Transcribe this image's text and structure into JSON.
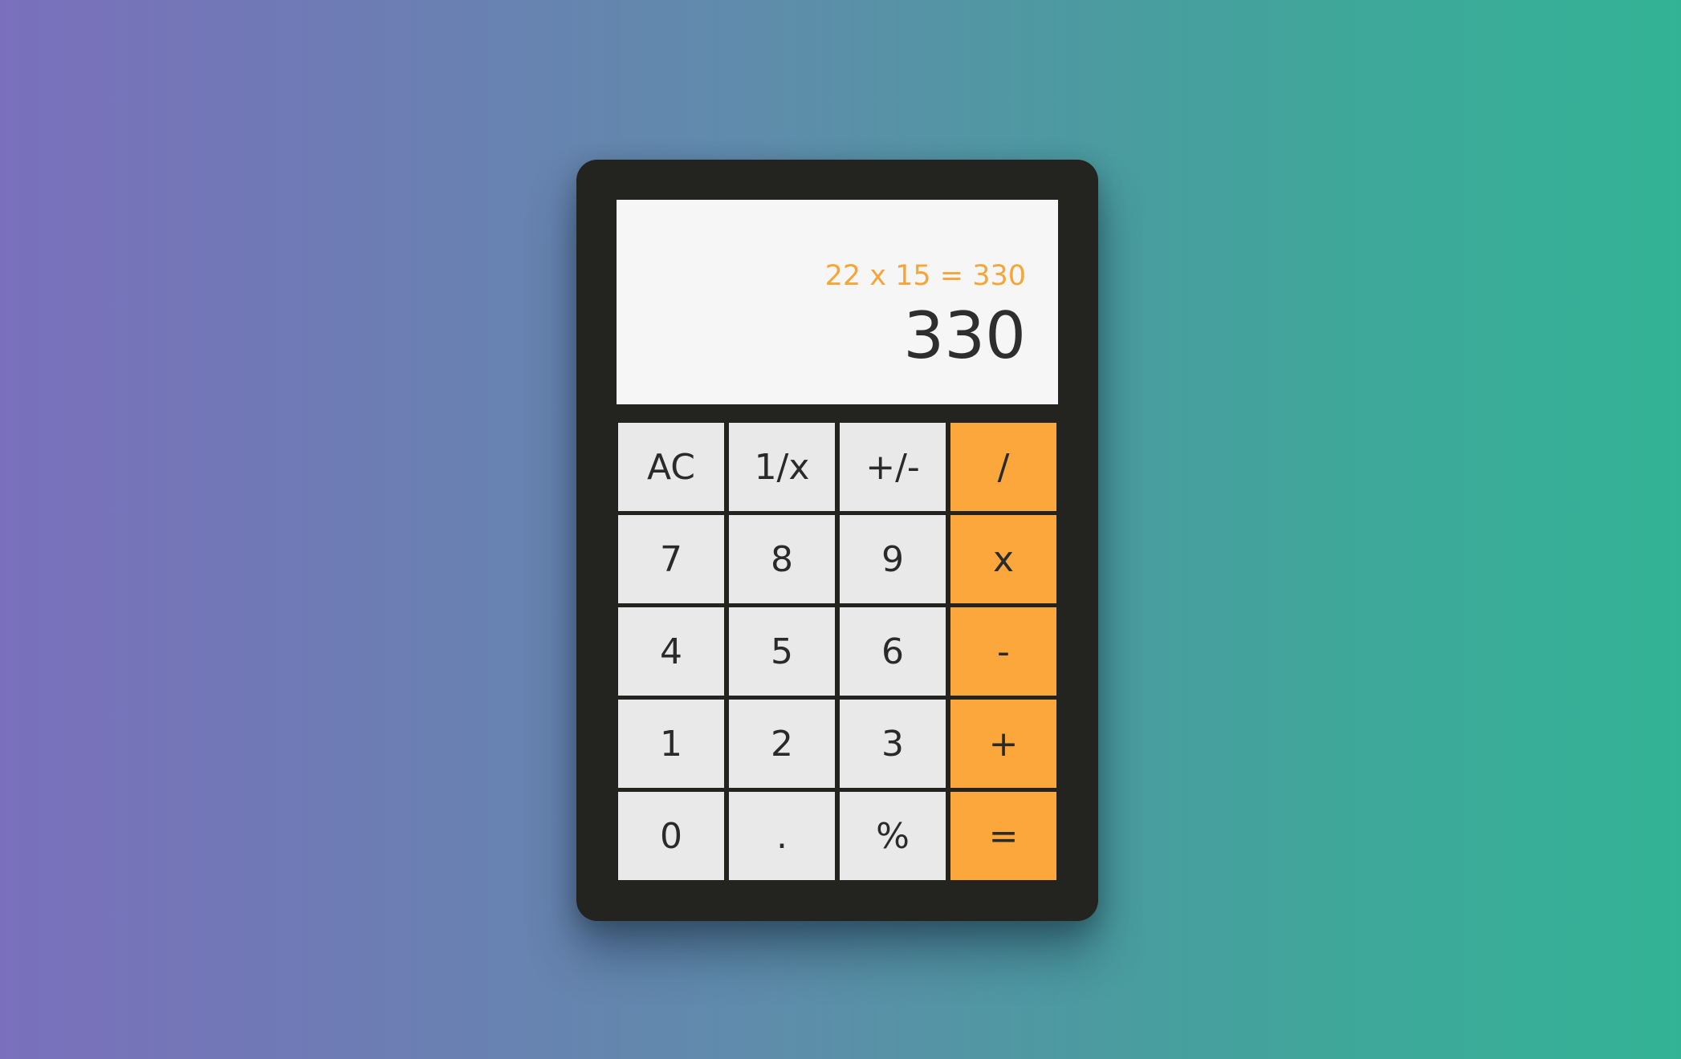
{
  "display": {
    "expression": "22 x 15 = 330",
    "result": "330"
  },
  "keys": [
    {
      "label": "AC",
      "name": "clear-button",
      "type": "function"
    },
    {
      "label": "1/x",
      "name": "reciprocal-button",
      "type": "function"
    },
    {
      "label": "+/-",
      "name": "toggle-sign-button",
      "type": "function"
    },
    {
      "label": "/",
      "name": "divide-button",
      "type": "operator"
    },
    {
      "label": "7",
      "name": "digit-7-button",
      "type": "digit"
    },
    {
      "label": "8",
      "name": "digit-8-button",
      "type": "digit"
    },
    {
      "label": "9",
      "name": "digit-9-button",
      "type": "digit"
    },
    {
      "label": "x",
      "name": "multiply-button",
      "type": "operator"
    },
    {
      "label": "4",
      "name": "digit-4-button",
      "type": "digit"
    },
    {
      "label": "5",
      "name": "digit-5-button",
      "type": "digit"
    },
    {
      "label": "6",
      "name": "digit-6-button",
      "type": "digit"
    },
    {
      "label": "-",
      "name": "subtract-button",
      "type": "operator"
    },
    {
      "label": "1",
      "name": "digit-1-button",
      "type": "digit"
    },
    {
      "label": "2",
      "name": "digit-2-button",
      "type": "digit"
    },
    {
      "label": "3",
      "name": "digit-3-button",
      "type": "digit"
    },
    {
      "label": "+",
      "name": "add-button",
      "type": "operator"
    },
    {
      "label": "0",
      "name": "digit-0-button",
      "type": "digit"
    },
    {
      "label": ".",
      "name": "decimal-button",
      "type": "digit"
    },
    {
      "label": "%",
      "name": "percent-button",
      "type": "function"
    },
    {
      "label": "=",
      "name": "equals-button",
      "type": "operator"
    }
  ],
  "colors": {
    "operator": "#fba73c",
    "key": "#e9e9e9",
    "body": "#23231f",
    "expression": "#f6a538",
    "screen": "#f6f6f6"
  }
}
